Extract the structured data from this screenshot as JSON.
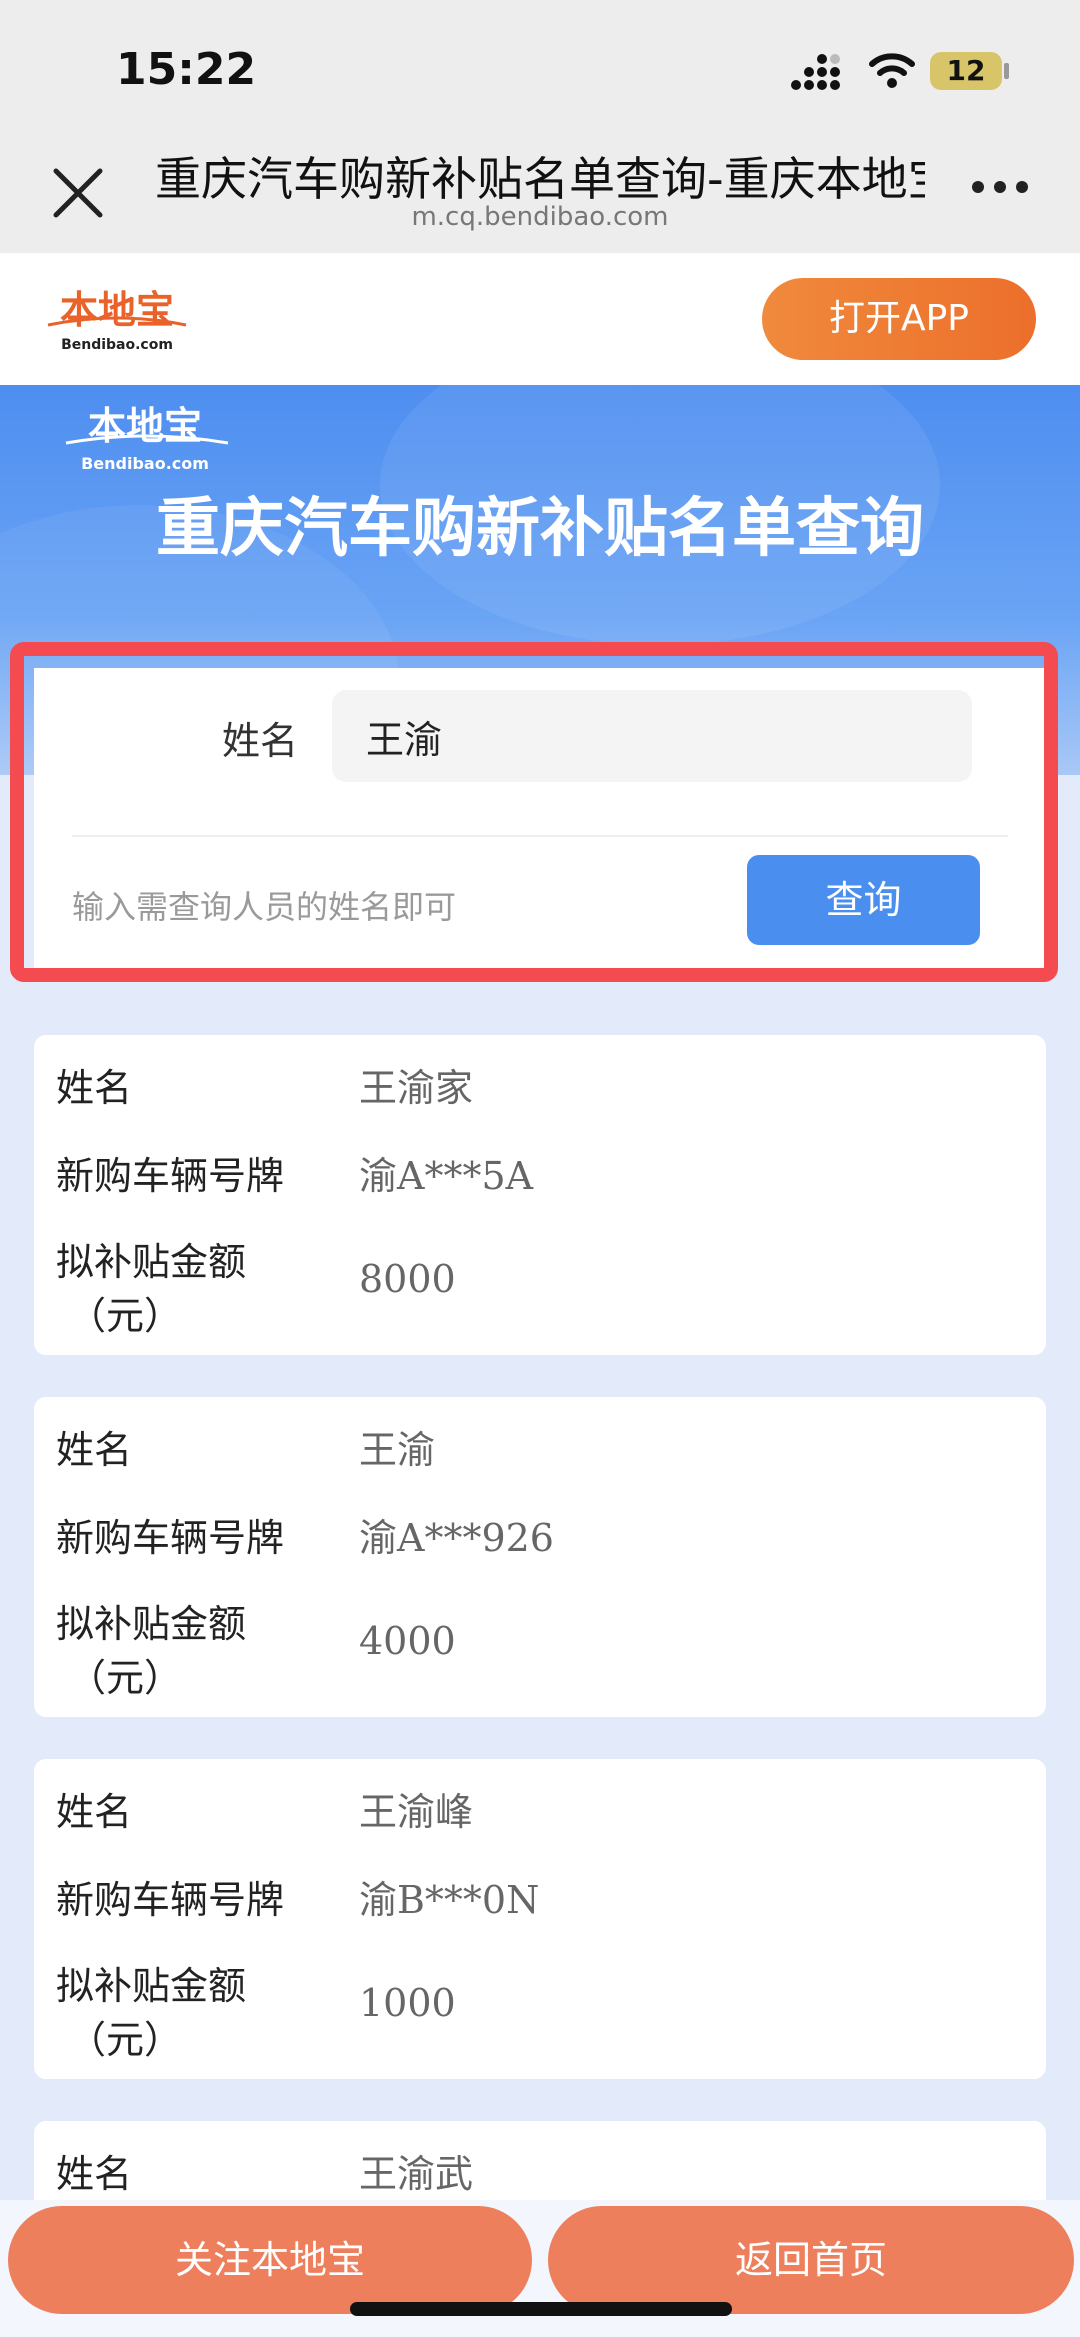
{
  "status_bar": {
    "time": "15:22",
    "battery": "12"
  },
  "browser": {
    "title": "重庆汽车购新补贴名单查询-重庆本地宝",
    "url": "m.cq.bendibao.com"
  },
  "site": {
    "logo_text": "本地宝",
    "logo_sub": "Bendibao.com",
    "open_app": "打开APP"
  },
  "banner": {
    "logo_text": "本地宝",
    "logo_sub": "Bendibao.com",
    "title": "重庆汽车购新补贴名单查询"
  },
  "search": {
    "name_label": "姓名",
    "name_value": "王渝",
    "hint": "输入需查询人员的姓名即可",
    "button": "查询"
  },
  "labels": {
    "name": "姓名",
    "plate": "新购车辆号牌",
    "amount_line1": "拟补贴金额",
    "amount_line2": "（元）"
  },
  "results": [
    {
      "name": "王渝家",
      "plate": "渝A***5A",
      "amount": "8000"
    },
    {
      "name": "王渝",
      "plate": "渝A***926",
      "amount": "4000"
    },
    {
      "name": "王渝峰",
      "plate": "渝B***0N",
      "amount": "1000"
    },
    {
      "name": "王渝武"
    }
  ],
  "bottom": {
    "follow": "关注本地宝",
    "home": "返回首页"
  },
  "colors": {
    "accent_blue": "#4a8ff0",
    "accent_orange": "#ee7f5c",
    "highlight_red": "#f34b4f"
  }
}
